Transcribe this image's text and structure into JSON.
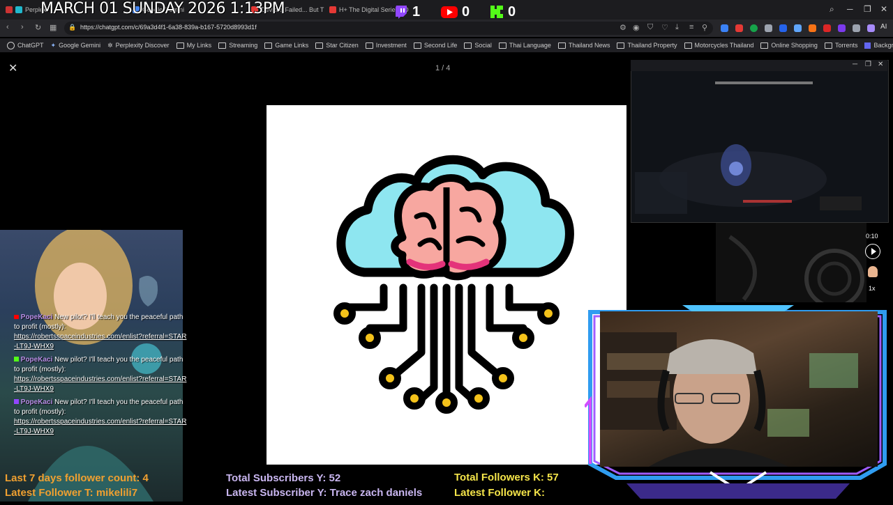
{
  "browser": {
    "tabs": [
      {
        "label": "Perplexi",
        "color": "#20b8cd"
      },
      {
        "label": "Google Gemini",
        "color": "#4285f4"
      },
      {
        "label": "Devices Failed... But Th",
        "color": "#e53935"
      },
      {
        "label": "H+ The Digital Series - D",
        "color": "#e53935"
      }
    ],
    "date_overlay": "MARCH 01 SUNDAY 2026 1:13PM",
    "counters": [
      {
        "name": "twitch",
        "value": "1",
        "color": "#9146ff"
      },
      {
        "name": "youtube",
        "value": "0",
        "color": "#ff0000"
      },
      {
        "name": "kick",
        "value": "0",
        "color": "#53fc18"
      }
    ],
    "url": "https://chatgpt.com/c/69a3d4f1-6a38-839a-b167-5720d8993d1f",
    "bookmarks": [
      {
        "label": "ChatGPT",
        "icon": "chatgpt-icon"
      },
      {
        "label": "Google Gemini",
        "icon": "gemini-icon"
      },
      {
        "label": "Perplexity Discover",
        "icon": "perplexity-icon"
      },
      {
        "label": "My Links",
        "icon": "folder-icon"
      },
      {
        "label": "Streaming",
        "icon": "folder-icon"
      },
      {
        "label": "Game Links",
        "icon": "folder-icon"
      },
      {
        "label": "Star Citizen",
        "icon": "folder-icon"
      },
      {
        "label": "Investment",
        "icon": "folder-icon"
      },
      {
        "label": "Second Life",
        "icon": "folder-icon"
      },
      {
        "label": "Social",
        "icon": "folder-icon"
      },
      {
        "label": "Thai Language",
        "icon": "folder-icon"
      },
      {
        "label": "Thailand News",
        "icon": "folder-icon"
      },
      {
        "label": "Thailand Property",
        "icon": "folder-icon"
      },
      {
        "label": "Motorcycles Thailand",
        "icon": "folder-icon"
      },
      {
        "label": "Online Shopping",
        "icon": "folder-icon"
      },
      {
        "label": "Torrents",
        "icon": "folder-icon"
      },
      {
        "label": "Background Remover",
        "icon": "remover-icon"
      }
    ],
    "extension_label": "AI"
  },
  "viewer": {
    "page_counter": "1 / 4"
  },
  "video": {
    "time": "0:10",
    "speed": "1x"
  },
  "chat": {
    "messages": [
      {
        "user": "PopeKaci",
        "text": "New pilot? I'll teach you the peaceful path to profit (mostly):",
        "link": "https://robertsspaceindustries.com/enlist?referral=STAR-LT9J-WHX9",
        "platform_color": "#ff0000"
      },
      {
        "user": "PopeKaci",
        "text": "New pilot? I'll teach you the peaceful path to profit (mostly):",
        "link": "https://robertsspaceindustries.com/enlist?referral=STAR-LT9J-WHX9",
        "platform_color": "#53fc18"
      },
      {
        "user": "PopeKaci",
        "text": "New pilot? I'll teach you the peaceful path to profit (mostly):",
        "link": "https://robertsspaceindustries.com/enlist?referral=STAR-LT9J-WHX9",
        "platform_color": "#9146ff"
      }
    ]
  },
  "stats": {
    "last7": "Last 7 days follower count: 4",
    "latest_follower_t": "Latest Follower T: mikelili7",
    "total_subs_y": "Total Subscribers Y: 52",
    "latest_sub_y": "Latest Subscriber Y: Trace zach daniels",
    "total_followers_k": "Total Followers K: 57",
    "latest_follower_k": "Latest Follower K:"
  }
}
